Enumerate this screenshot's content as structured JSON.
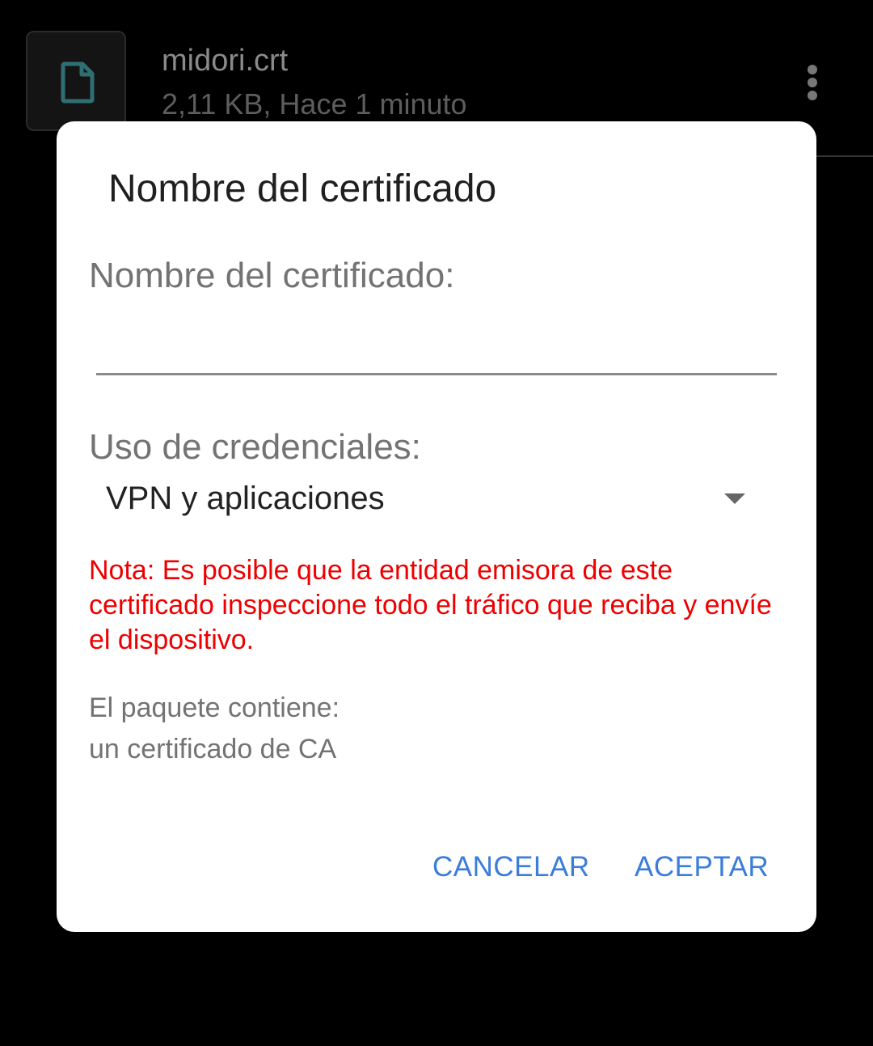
{
  "background_file": {
    "name": "midori.crt",
    "meta": "2,11 KB, Hace 1 minuto",
    "thumbnail_icon": "file-icon",
    "menu_icon": "more-vert-icon"
  },
  "dialog": {
    "title": "Nombre del certificado",
    "name_field": {
      "label": "Nombre del certificado:",
      "value": ""
    },
    "usage": {
      "label": "Uso de credenciales:",
      "selected": "VPN y aplicaciones",
      "arrow_icon": "dropdown-arrow-icon"
    },
    "note": "Nota: Es posible que la entidad emisora de este certificado inspeccione todo el tráfico que reciba y envíe el dispositivo.",
    "package": {
      "label": "El paquete contiene:",
      "content": "un certificado de CA"
    },
    "buttons": {
      "cancel": "CANCELAR",
      "accept": "ACEPTAR"
    }
  },
  "colors": {
    "accent": "#3b7ddb",
    "warning": "#ee0000",
    "dialog_bg": "#ffffff",
    "screen_bg": "#000000"
  }
}
